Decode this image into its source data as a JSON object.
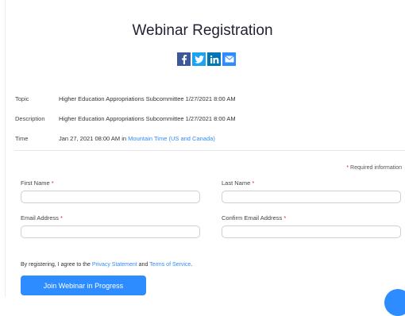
{
  "page": {
    "title": "Webinar Registration"
  },
  "share": [
    {
      "name": "facebook-icon",
      "color": "#3b5998"
    },
    {
      "name": "twitter-icon",
      "color": "#1da1f2"
    },
    {
      "name": "linkedin-icon",
      "color": "#0077b5"
    },
    {
      "name": "email-icon",
      "color": "#2d8cff"
    }
  ],
  "info": {
    "topic": {
      "label": "Topic",
      "value": "Higher Education Appropriations Subcommittee 1/27/2021 8:00 AM"
    },
    "description": {
      "label": "Description",
      "value": "Higher Education Appropriations Subcommittee 1/27/2021 8:00 AM"
    },
    "time": {
      "label": "Time",
      "value": "Jan 27, 2021 08:00 AM in",
      "timezone": "Mountain Time (US and Canada)"
    }
  },
  "form": {
    "required_note": "Required information",
    "first_name": {
      "label": "First Name",
      "value": ""
    },
    "last_name": {
      "label": "Last Name",
      "value": ""
    },
    "email": {
      "label": "Email Address",
      "value": ""
    },
    "confirm_email": {
      "label": "Confirm Email Address",
      "value": ""
    },
    "required_marker": "*"
  },
  "consent": {
    "prefix": "By registering, I agree to the",
    "privacy": "Privacy Statement",
    "and": "and",
    "terms": "Terms of Service",
    "suffix": "."
  },
  "actions": {
    "join_label": "Join Webinar in Progress"
  },
  "colors": {
    "accent": "#2d8cff",
    "required": "#e02828"
  }
}
